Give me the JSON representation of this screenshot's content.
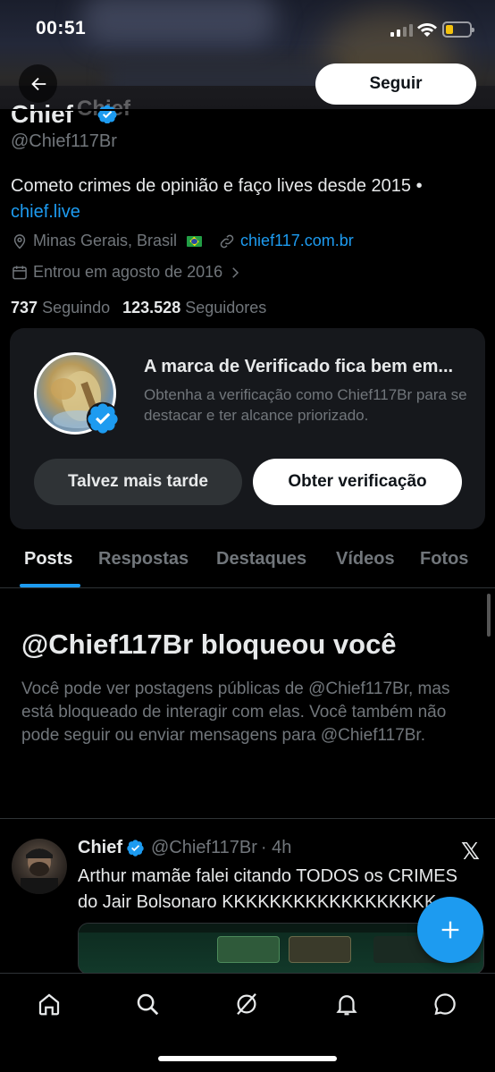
{
  "status_bar": {
    "time": "00:51"
  },
  "header": {
    "follow_label": "Seguir"
  },
  "profile": {
    "name": "Chief",
    "name_ghost": "Chief",
    "handle": "@Chief117Br",
    "bio": "Cometo crimes de opinião e faço lives desde 2015 •",
    "bio_link": "chief.live",
    "location": "Minas Gerais, Brasil",
    "website": "chief117.com.br",
    "joined": "Entrou em agosto de 2016",
    "following_count": "737",
    "following_label": "Seguindo",
    "followers_count": "123.528",
    "followers_label": "Seguidores"
  },
  "verification_card": {
    "title": "A marca de Verificado fica bem em...",
    "text": "Obtenha a verificação como Chief117Br para se destacar e ter alcance priorizado.",
    "later_label": "Talvez mais tarde",
    "verify_label": "Obter verificação"
  },
  "tabs": [
    {
      "label": "Posts",
      "active": true
    },
    {
      "label": "Respostas",
      "active": false
    },
    {
      "label": "Destaques",
      "active": false
    },
    {
      "label": "Vídeos",
      "active": false
    },
    {
      "label": "Fotos",
      "active": false
    }
  ],
  "blocked": {
    "title": "@Chief117Br bloqueou você",
    "text": "Você pode ver postagens públicas de @Chief117Br, mas está bloqueado de interagir com elas. Você também não pode seguir ou enviar mensagens para @Chief117Br."
  },
  "tweet": {
    "name": "Chief",
    "handle": "@Chief117Br",
    "time": "· 4h",
    "line1": "Arthur mamãe falei citando TODOS os CRIMES",
    "line2": "do Jair Bolsonaro KKKKKKKKKKKKKKKKKK",
    "source_icon": "x-logo"
  },
  "nav": {
    "icons": [
      "home-icon",
      "search-icon",
      "grok-icon",
      "bell-icon",
      "messages-icon"
    ]
  },
  "colors": {
    "accent": "#1d9bf0",
    "background": "#000000",
    "card": "#16181c",
    "secondary_text": "#71767b"
  }
}
